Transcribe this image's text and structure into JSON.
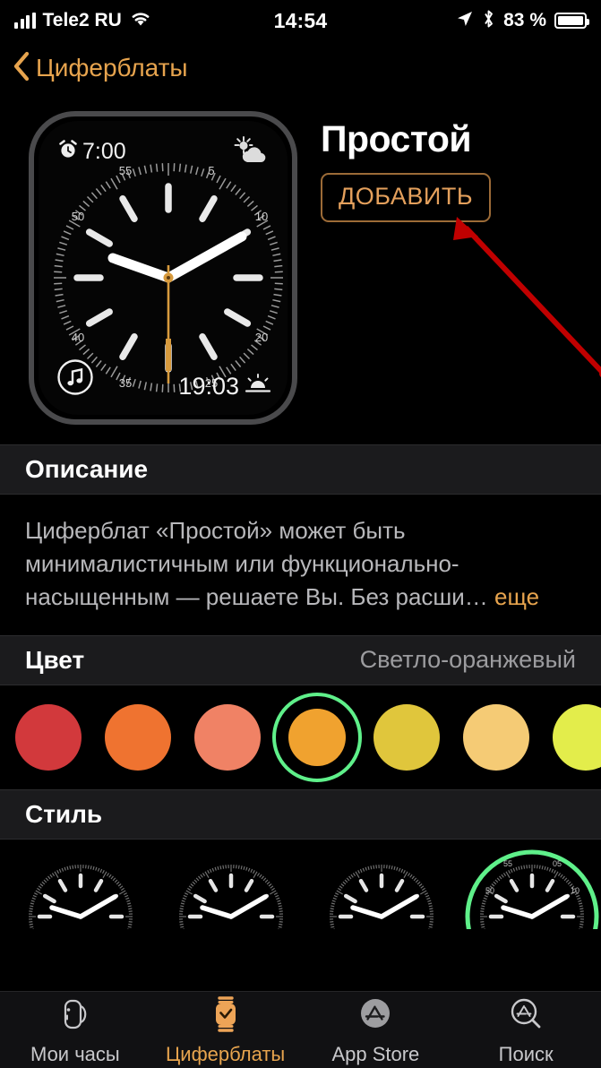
{
  "status_bar": {
    "carrier": "Tele2 RU",
    "time": "14:54",
    "battery_percent": "83 %",
    "icons": [
      "signal-bars-icon",
      "wifi-icon",
      "location-arrow-icon",
      "bluetooth-icon",
      "battery-icon"
    ]
  },
  "nav": {
    "back_label": "Циферблаты",
    "back_icon": "chevron-left-icon"
  },
  "hero": {
    "face_title": "Простой",
    "add_button": "ДОБАВИТЬ",
    "annotation": "red-arrow-annotation",
    "watch_preview": {
      "alarm_complication": "7:00",
      "alarm_icon": "alarm-clock-icon",
      "weather_icon": "sun-behind-cloud-icon",
      "music_icon": "music-note-icon",
      "sunset_time": "19:03",
      "sunset_icon": "sunset-icon",
      "dial_numbers": [
        "55",
        "5",
        "50",
        "10",
        "40",
        "20",
        "35",
        "25"
      ]
    }
  },
  "description": {
    "header": "Описание",
    "text": "Циферблат «Простой» может быть минималистичным или функционально-насыщенным — решаете Вы. Без расши…",
    "more_label": "еще"
  },
  "color": {
    "header": "Цвет",
    "selected_value": "Светло-оранжевый",
    "selected_index": 3,
    "swatches": [
      "#d2393c",
      "#ef7330",
      "#f08265",
      "#f0a22f",
      "#e0c63c",
      "#f5cb75",
      "#e3ed4b"
    ],
    "selection_ring": "#5ff08a"
  },
  "style": {
    "header": "Стиль",
    "selected_index": 3,
    "items": [
      "style-1",
      "style-2",
      "style-3",
      "style-4"
    ],
    "selection_ring": "#5ff08a"
  },
  "tabs": [
    {
      "label": "Мои часы",
      "icon": "watch-side-icon",
      "active": false
    },
    {
      "label": "Циферблаты",
      "icon": "watch-face-icon",
      "active": true
    },
    {
      "label": "App Store",
      "icon": "app-store-icon",
      "active": false
    },
    {
      "label": "Поиск",
      "icon": "app-store-search-icon",
      "active": false
    }
  ],
  "theme": {
    "accent": "#e7a44e",
    "background": "#000000",
    "section_header_bg": "#1b1b1d",
    "annotation_color": "#c00000"
  }
}
